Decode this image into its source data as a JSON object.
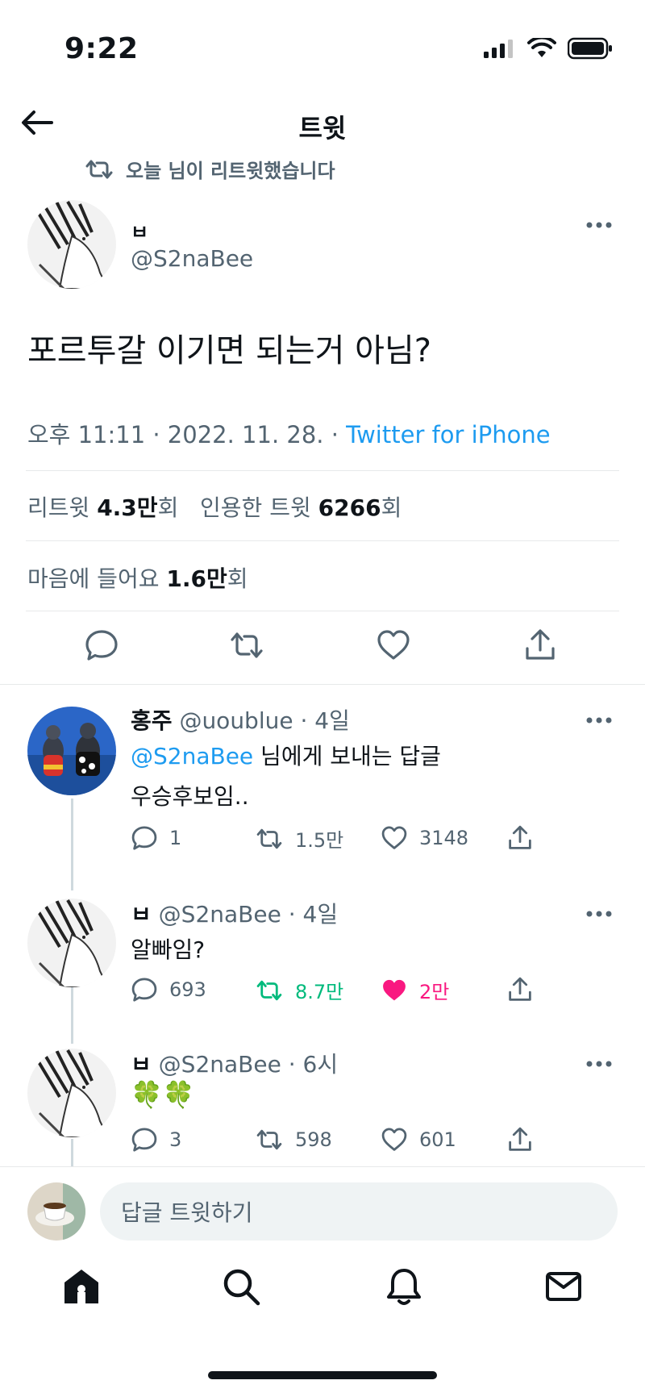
{
  "status_bar": {
    "time": "9:22"
  },
  "nav": {
    "title": "트윗"
  },
  "retweet_context": "오늘 님이 리트윗했습니다",
  "main_tweet": {
    "name": "ㅂ",
    "handle": "@S2naBee",
    "text": "포르투갈 이기면 되는거 아님?",
    "timestamp": "오후 11:11 · 2022. 11. 28. · ",
    "source": "Twitter for iPhone",
    "retweets_label": "리트윗 ",
    "retweets_value": "4.3만",
    "retweets_suffix": "회",
    "quotes_label": "인용한 트윗 ",
    "quotes_value": "6266",
    "quotes_suffix": "회",
    "likes_label": "마음에 들어요 ",
    "likes_value": "1.6만",
    "likes_suffix": "회"
  },
  "replies": [
    {
      "name": "홍주",
      "handle": "@uoublue",
      "time": "· 4일",
      "reply_to_mention": "@S2naBee",
      "reply_to_suffix": " 님에게 보내는 답글",
      "text": "우승후보임..",
      "reply_count": "1",
      "retweet_count": "1.5만",
      "like_count": "3148"
    },
    {
      "name": "ㅂ",
      "handle": "@S2naBee",
      "time": "· 4일",
      "text": "알빠임?",
      "reply_count": "693",
      "retweet_count": "8.7만",
      "like_count": "2만"
    },
    {
      "name": "ㅂ",
      "handle": "@S2naBee",
      "time": "· 6시",
      "text": "🍀🍀",
      "reply_count": "3",
      "retweet_count": "598",
      "like_count": "601"
    }
  ],
  "composer": {
    "placeholder": "답글 트윗하기"
  },
  "colors": {
    "accent": "#1d9bf0",
    "retweet_green": "#00ba7c",
    "like_pink": "#f91880",
    "muted": "#536471"
  },
  "icons": [
    "back-arrow-icon",
    "retweet-icon",
    "more-icon",
    "reply-icon",
    "like-icon",
    "share-icon",
    "home-icon",
    "search-icon",
    "bell-icon",
    "mail-icon"
  ]
}
